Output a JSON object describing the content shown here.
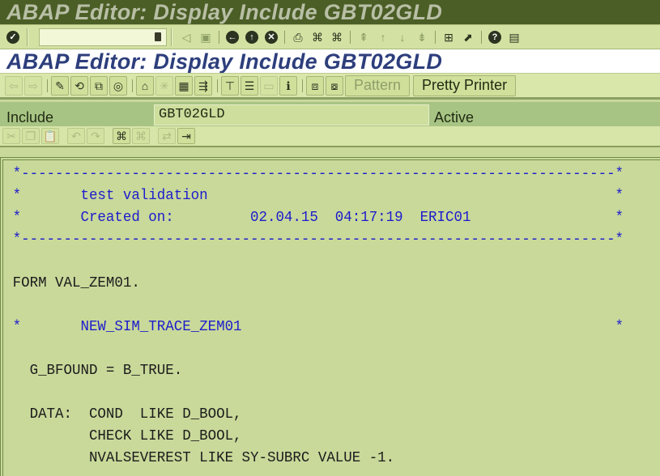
{
  "window": {
    "title": "ABAP Editor: Display Include GBT02GLD"
  },
  "system_toolbar": {
    "command_field": {
      "value": "",
      "placeholder": ""
    },
    "icons": [
      "enter-icon",
      "command-dropdown-icon",
      "back-arrow-icon",
      "save-icon",
      "back-icon",
      "exit-icon",
      "cancel-icon",
      "print-icon",
      "find-icon",
      "find-next-icon",
      "first-page-icon",
      "previous-page-icon",
      "next-page-icon",
      "last-page-icon",
      "create-session-icon",
      "shortcut-icon",
      "help-icon",
      "customize-layout-icon"
    ]
  },
  "app": {
    "title": "ABAP Editor: Display Include GBT02GLD",
    "toolbar": {
      "icons": [
        "back-nav-icon",
        "forward-nav-icon",
        "display-change-icon",
        "other-object-icon",
        "active-inactive-icon",
        "check-icon",
        "activate-icon",
        "test-icon",
        "where-used-icon",
        "object-list-icon",
        "navigation-window-icon",
        "display-object-list-icon",
        "hierarchy-icon",
        "stack-icon",
        "help-on-icon",
        "info-icon",
        "breakpoint-icon",
        "user-breakpoint-icon"
      ],
      "pattern_label": "Pattern",
      "pretty_printer_label": "Pretty Printer"
    }
  },
  "header": {
    "include_label": "Include",
    "include_value": "GBT02GLD",
    "status": "Active"
  },
  "editor_toolbar": {
    "icons": [
      "cut-icon",
      "copy-icon",
      "paste-icon",
      "undo-icon",
      "redo-icon",
      "find-icon",
      "find-next-icon",
      "upload-icon",
      "download-icon"
    ]
  },
  "editor": {
    "lines": [
      {
        "type": "comment",
        "text": "*----------------------------------------------------------------------*"
      },
      {
        "type": "comment",
        "text": "*       test validation                                                *"
      },
      {
        "type": "comment",
        "text": "*       Created on:         02.04.15  04:17:19  ERIC01                 *"
      },
      {
        "type": "comment",
        "text": "*----------------------------------------------------------------------*"
      },
      {
        "type": "code",
        "text": ""
      },
      {
        "type": "code",
        "text": "FORM VAL_ZEM01."
      },
      {
        "type": "code",
        "text": ""
      },
      {
        "type": "comment",
        "text": "*       NEW_SIM_TRACE_ZEM01                                            *"
      },
      {
        "type": "code",
        "text": ""
      },
      {
        "type": "code",
        "text": "  G_BFOUND = B_TRUE."
      },
      {
        "type": "code",
        "text": ""
      },
      {
        "type": "code",
        "text": "  DATA:  COND  LIKE D_BOOL,"
      },
      {
        "type": "code",
        "text": "         CHECK LIKE D_BOOL,"
      },
      {
        "type": "code",
        "text": "         NVALSEVEREST LIKE SY-SUBRC VALUE -1."
      }
    ]
  }
}
